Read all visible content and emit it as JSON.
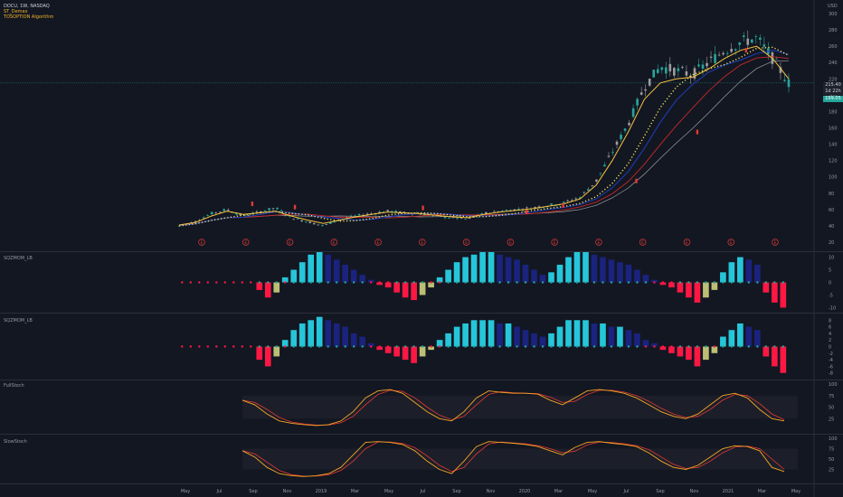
{
  "header": {
    "symbol_line": "DOCU, 1W, NASDAQ",
    "line2": "ST_Demax",
    "line3": "TOSOPTION Algorithm"
  },
  "price_scale": {
    "currency": "USD",
    "ticks": [
      "300",
      "280",
      "260",
      "240",
      "220",
      "200",
      "180",
      "160",
      "140",
      "120",
      "100",
      "80",
      "60",
      "40",
      "20"
    ],
    "current_price": "215.40",
    "current_label": "1d 22h",
    "badge_label": "199.05"
  },
  "panes": [
    {
      "id": "sqzmom1",
      "label": "SQZMOM_LB",
      "ticks": [
        "10",
        "5",
        "0",
        "-5",
        "-10"
      ]
    },
    {
      "id": "sqzmom2",
      "label": "SQZMOM_LB",
      "ticks": [
        "8",
        "6",
        "4",
        "2",
        "0",
        "-2",
        "-4",
        "-6",
        "-8"
      ]
    },
    {
      "id": "fullstoch",
      "label": "FullStoch",
      "ticks": [
        "100",
        "75",
        "50",
        "25"
      ]
    },
    {
      "id": "slowstoch",
      "label": "SlowStoch",
      "ticks": [
        "100",
        "75",
        "50",
        "25"
      ]
    }
  ],
  "x_axis": {
    "ticks": [
      "May",
      "Jul",
      "Sep",
      "Nov",
      "2019",
      "Mar",
      "May",
      "Jul",
      "Sep",
      "Nov",
      "2020",
      "Mar",
      "May",
      "Jul",
      "Sep",
      "Nov",
      "2021",
      "Mar",
      "May"
    ]
  },
  "earnings_markers": [
    "E",
    "E",
    "E",
    "E",
    "E",
    "E",
    "E",
    "E",
    "E",
    "E",
    "E",
    "E",
    "E",
    "E"
  ],
  "colors": {
    "background": "#131722",
    "bull_candle": "#26a69a",
    "bear_candle": "#9e9e9e",
    "ema_fast": "#f7c33f",
    "ma_dotted": "#f5e663",
    "ma_blue": "#1f3fbf",
    "ma_red": "#c62828",
    "ma_grey": "#9e9e9e",
    "mom_cyan": "#26c6da",
    "mom_navy": "#1a237e",
    "mom_red": "#ff1744",
    "mom_olive": "#bcbf73",
    "stoch": "#f5a623",
    "stoch_sig": "#e53935",
    "badge": "#26a69a",
    "earn": "#e53935"
  },
  "chart_data": [
    {
      "type": "line",
      "title": "",
      "series": [
        {
          "name": "Close",
          "values": [
            40,
            45,
            55,
            60,
            52,
            57,
            62,
            50,
            45,
            40,
            48,
            52,
            55,
            58,
            56,
            55,
            52,
            50,
            48,
            55,
            58,
            60,
            62,
            65,
            68,
            75,
            95,
            130,
            165,
            210,
            235,
            230,
            225,
            240,
            255,
            265,
            270,
            245,
            215
          ]
        },
        {
          "name": "",
          "values": [
            41,
            44,
            52,
            58,
            54,
            56,
            58,
            52,
            47,
            43,
            47,
            51,
            54,
            57,
            56,
            55,
            53,
            51,
            50,
            54,
            57,
            59,
            61,
            64,
            67,
            73,
            90,
            120,
            155,
            195,
            215,
            220,
            222,
            232,
            245,
            255,
            260,
            245,
            220
          ]
        }
      ],
      "ylim": [
        20,
        310
      ]
    },
    {
      "type": "bar",
      "title": "SQZMOM_LB",
      "values": [
        0,
        0,
        0,
        0,
        0,
        0,
        0,
        0,
        0,
        -3,
        -6,
        -4,
        2,
        5,
        8,
        11,
        12,
        11,
        9,
        7,
        5,
        3,
        1,
        -1,
        -2,
        -4,
        -6,
        -7,
        -5,
        -2,
        2,
        5,
        8,
        10,
        11,
        12,
        12,
        11,
        10,
        9,
        7,
        5,
        3,
        4,
        7,
        10,
        12,
        12,
        11,
        10,
        9,
        8,
        7,
        5,
        3,
        1,
        -1,
        -2,
        -4,
        -6,
        -8,
        -6,
        -3,
        4,
        8,
        10,
        9,
        7,
        -4,
        -8,
        -10
      ],
      "ylim": [
        -12,
        12
      ]
    },
    {
      "type": "bar",
      "title": "SQZMOM_LB",
      "values": [
        0,
        0,
        0,
        0,
        0,
        0,
        0,
        0,
        0,
        -4,
        -6,
        -3,
        2,
        5,
        7,
        8,
        9,
        8,
        7,
        6,
        4,
        3,
        1,
        -1,
        -2,
        -3,
        -4,
        -5,
        -3,
        -1,
        2,
        4,
        6,
        7,
        8,
        8,
        8,
        7,
        7,
        6,
        5,
        4,
        3,
        4,
        6,
        8,
        8,
        8,
        7,
        7,
        6,
        6,
        5,
        4,
        2,
        1,
        -1,
        -2,
        -3,
        -4,
        -6,
        -4,
        -2,
        3,
        5,
        7,
        6,
        5,
        -3,
        -6,
        -8
      ],
      "ylim": [
        -10,
        10
      ]
    },
    {
      "type": "line",
      "title": "FullStoch",
      "values": [
        65,
        55,
        35,
        20,
        15,
        12,
        10,
        12,
        20,
        40,
        70,
        85,
        88,
        80,
        60,
        40,
        25,
        20,
        40,
        70,
        85,
        82,
        80,
        80,
        78,
        65,
        55,
        70,
        85,
        88,
        85,
        80,
        70,
        55,
        40,
        30,
        25,
        35,
        55,
        75,
        80,
        70,
        45,
        25,
        20
      ],
      "ylim": [
        0,
        100
      ]
    },
    {
      "type": "line",
      "title": "SlowStoch",
      "values": [
        70,
        55,
        30,
        15,
        10,
        8,
        10,
        15,
        30,
        60,
        90,
        92,
        90,
        85,
        70,
        45,
        25,
        15,
        45,
        80,
        92,
        90,
        88,
        85,
        80,
        70,
        60,
        78,
        90,
        92,
        88,
        85,
        80,
        65,
        45,
        30,
        25,
        35,
        55,
        75,
        82,
        80,
        70,
        30,
        20
      ],
      "ylim": [
        0,
        100
      ]
    }
  ]
}
